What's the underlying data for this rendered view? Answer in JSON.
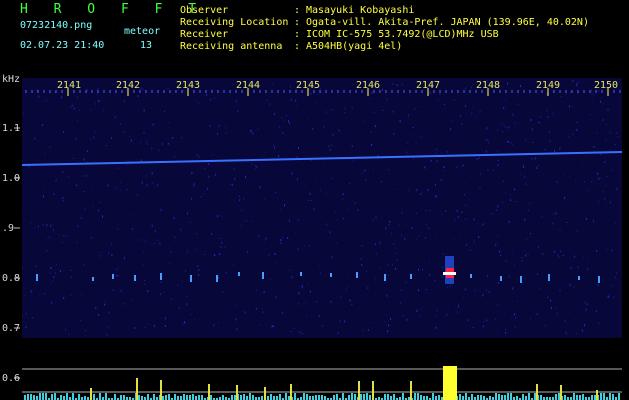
{
  "header": {
    "brand": "H R O F F T",
    "filename": "07232140.png",
    "datetime": "02.07.23 21:40",
    "meteor_label": "meteor",
    "meteor_count": "13",
    "fields": [
      {
        "label": "Observer",
        "value": "Masayuki Kobayashi"
      },
      {
        "label": "Receiving Location",
        "value": "Ogata-vill. Akita-Pref. JAPAN (139.96E, 40.02N)"
      },
      {
        "label": "Receiver",
        "value": "ICOM IC-575 53.7492(@LCD)MHz USB"
      },
      {
        "label": "Receiving antenna",
        "value": "A504HB(yagi 4el)"
      }
    ]
  },
  "axes": {
    "y_unit": "kHz",
    "y_ticks": [
      "1.1",
      "1.0",
      ".9",
      "0.8",
      "0.7",
      "0.6"
    ],
    "x_ticks": [
      "2141",
      "2142",
      "2143",
      "2144",
      "2145",
      "2146",
      "2147",
      "2148",
      "2149",
      "2150"
    ]
  },
  "colors": {
    "background": "#000000",
    "spectrogram": "#0a0a48",
    "carrier_line": "#3060ff",
    "meteor_echo": "#ff3040",
    "level_bar": "#ffff30",
    "level_noise": "#40ffff"
  }
}
